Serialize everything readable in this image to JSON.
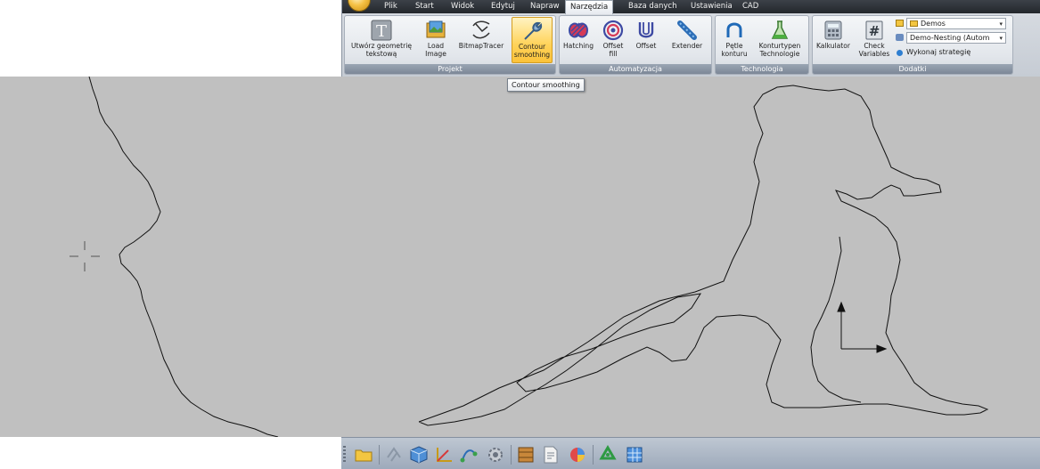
{
  "menubar": {
    "tabs": [
      {
        "label": "Plik"
      },
      {
        "label": "Start"
      },
      {
        "label": "Widok"
      },
      {
        "label": "Edytuj"
      },
      {
        "label": "Napraw"
      },
      {
        "label": "Narzędzia"
      },
      {
        "label": "Baza danych"
      },
      {
        "label": "Ustawienia"
      },
      {
        "label": "CAD"
      }
    ],
    "active_tab": "Narzędzia"
  },
  "ribbon": {
    "groups": {
      "projekt": {
        "label": "Projekt",
        "buttons": [
          {
            "label": "Utwórz geometrię\ntekstową",
            "icon": "text-geometry-icon"
          },
          {
            "label": "Load\nImage",
            "icon": "load-image-icon"
          },
          {
            "label": "BitmapTracer",
            "icon": "bitmap-tracer-icon"
          },
          {
            "label": "Contour\nsmoothing",
            "icon": "wrench-icon",
            "active": true
          }
        ]
      },
      "automatyzacja": {
        "label": "Automatyzacja",
        "buttons": [
          {
            "label": "Hatching",
            "icon": "hatching-icon"
          },
          {
            "label": "Offset\nfill",
            "icon": "offset-fill-icon"
          },
          {
            "label": "Offset",
            "icon": "offset-icon"
          },
          {
            "label": "Extender",
            "icon": "extender-icon"
          }
        ]
      },
      "technologia": {
        "label": "Technologia",
        "buttons": [
          {
            "label": "Pętle\nkonturu",
            "icon": "contour-loop-icon"
          },
          {
            "label": "Konturtypen\nTechnologie",
            "icon": "flask-icon"
          }
        ]
      },
      "dodatki": {
        "label": "Dodatki",
        "buttons": [
          {
            "label": "Kalkulator",
            "icon": "calculator-icon"
          },
          {
            "label": "Check\nVariables",
            "icon": "hash-icon"
          }
        ],
        "folder_dropdown": "Demos",
        "strategy_dropdown": "Demo-Nesting (Autom",
        "run_strategy_label": "Wykonaj strategię"
      }
    }
  },
  "tooltip": {
    "text": "Contour smoothing"
  },
  "colors": {
    "canvas_bg": "#c0c0c0",
    "contour": "#111111",
    "active_button": "#ffd35a",
    "group_label_bg": "#8a96a6"
  },
  "bottom_toolbar": {
    "icons": [
      "folder-icon",
      "layers-icon",
      "cube-icon",
      "axes-icon",
      "node-edit-icon",
      "gear-icon",
      "film-icon",
      "document-icon",
      "paint-icon",
      "recycle-icon",
      "grid-icon"
    ]
  }
}
